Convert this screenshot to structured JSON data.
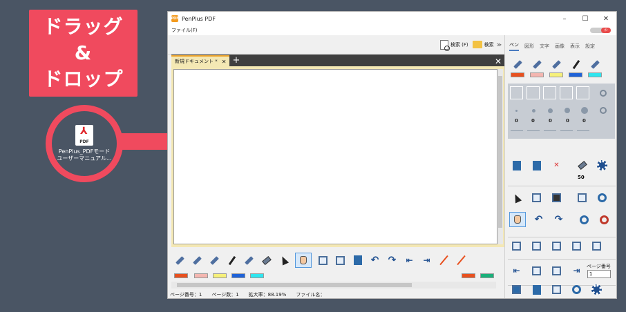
{
  "overlay": {
    "callout_lines": [
      "ドラッグ",
      "&",
      "ドロップ"
    ],
    "file_icon_text": "PDF",
    "file_name_lines": [
      "PenPlus_PDFモード",
      "ユーザーマニュアル..."
    ]
  },
  "window": {
    "title": "PenPlus PDF",
    "logo_text": "PDF",
    "controls": [
      "–",
      "☐",
      "✕"
    ],
    "menu": {
      "file": "ファイル(F)"
    },
    "toggle_label": "ｵﾝ"
  },
  "search": {
    "search_label": "検索 (F)",
    "search2_label": "検索",
    "chevron": "≫"
  },
  "tabs": [
    {
      "label": "新規ドキュメント *",
      "close": "✕"
    }
  ],
  "tab_add": "+",
  "tab_close_all": "✕",
  "bottom_colors": [
    "#e8501e",
    "#f4b6b0",
    "#f6f07a",
    "#1e62d8",
    "#2ee6f0"
  ],
  "bottom_line_colors": [
    "#e8501e",
    "#1ab07a"
  ],
  "status": {
    "page_no": "ページ番号：1",
    "page_count": "ページ数：1",
    "zoom": "拡大率：88.19%",
    "file_name": "ファイル名："
  },
  "right_panel": {
    "tabs": [
      "ペン",
      "図形",
      "文字",
      "画像",
      "表示",
      "設定"
    ],
    "pen_colors": [
      "#e8501e",
      "#f4b6b0",
      "#f6f07a",
      "#1e62d8",
      "#2ee6f0"
    ],
    "zeros": [
      "0",
      "0",
      "0",
      "0",
      "0"
    ],
    "eraser_size": "50",
    "page_number_label": "ページ番号",
    "page_number_value": "1"
  }
}
